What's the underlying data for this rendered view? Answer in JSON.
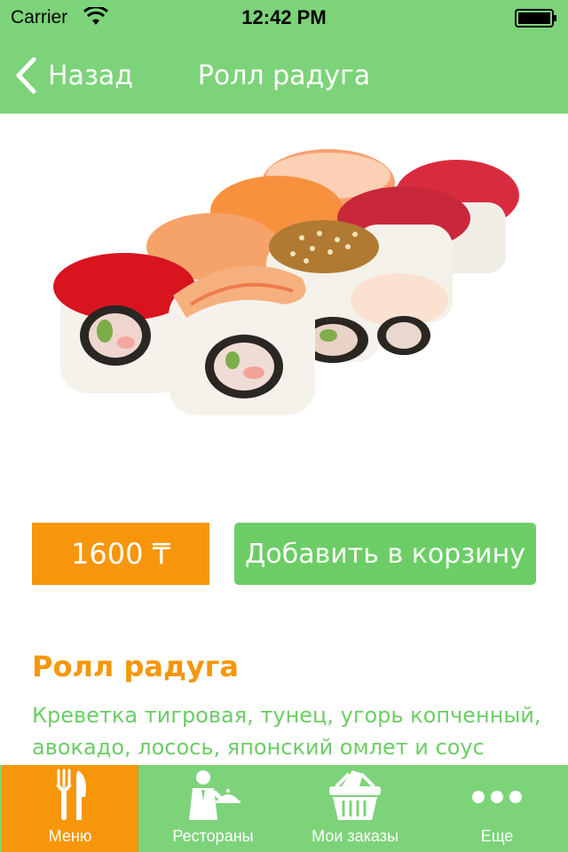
{
  "status_bar": {
    "carrier": "Carrier",
    "time": "12:42 PM"
  },
  "nav": {
    "back_label": "Назад",
    "title": "Ролл радуга"
  },
  "product": {
    "price": "1600 ₸",
    "add_to_cart_label": "Добавить в корзину",
    "name": "Ролл радуга",
    "description": "Креветка тигровая, тунец, угорь копченный, авокадо, лосось, японский омлет и соус"
  },
  "tab_bar": {
    "items": [
      {
        "label": "Меню",
        "icon": "fork-knife-icon",
        "active": true
      },
      {
        "label": "Рестораны",
        "icon": "waiter-icon",
        "active": false
      },
      {
        "label": "Мои заказы",
        "icon": "basket-icon",
        "active": false
      },
      {
        "label": "Еще",
        "icon": "more-dots-icon",
        "active": false
      }
    ]
  },
  "colors": {
    "bar_green": "#7dd37a",
    "button_green": "#6ccd66",
    "accent_orange": "#f7960a"
  }
}
